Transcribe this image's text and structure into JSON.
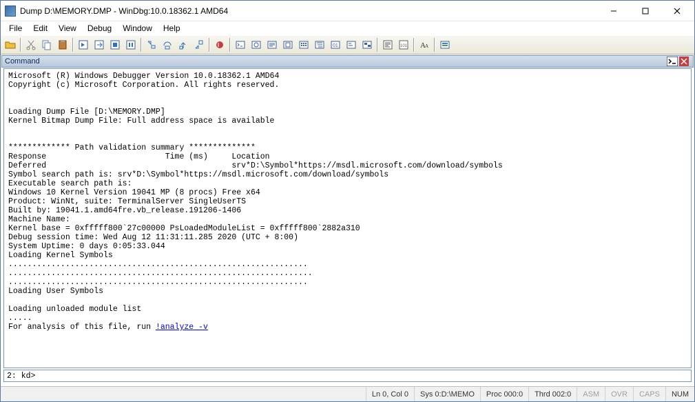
{
  "window": {
    "title": "Dump D:\\MEMORY.DMP - WinDbg:10.0.18362.1 AMD64"
  },
  "menu": {
    "file": "File",
    "edit": "Edit",
    "view": "View",
    "debug": "Debug",
    "window": "Window",
    "help": "Help"
  },
  "command": {
    "title": "Command",
    "text": "Microsoft (R) Windows Debugger Version 10.0.18362.1 AMD64\nCopyright (c) Microsoft Corporation. All rights reserved.\n\n\nLoading Dump File [D:\\MEMORY.DMP]\nKernel Bitmap Dump File: Full address space is available\n\n\n************* Path validation summary **************\nResponse                         Time (ms)     Location\nDeferred                                       srv*D:\\Symbol*https://msdl.microsoft.com/download/symbols\nSymbol search path is: srv*D:\\Symbol*https://msdl.microsoft.com/download/symbols\nExecutable search path is: \nWindows 10 Kernel Version 19041 MP (8 procs) Free x64\nProduct: WinNt, suite: TerminalServer SingleUserTS\nBuilt by: 19041.1.amd64fre.vb_release.191206-1406\nMachine Name:\nKernel base = 0xfffff800`27c00000 PsLoadedModuleList = 0xfffff800`2882a310\nDebug session time: Wed Aug 12 11:31:11.285 2020 (UTC + 8:00)\nSystem Uptime: 0 days 0:05:33.044\nLoading Kernel Symbols\n...............................................................\n................................................................\n...............................................................\nLoading User Symbols\n\nLoading unloaded module list\n.....\nFor analysis of this file, run ",
    "link": "!analyze -v",
    "prompt": "2: kd>"
  },
  "status": {
    "lncol": "Ln 0, Col 0",
    "sys": "Sys 0:D:\\MEMO",
    "proc": "Proc 000:0",
    "thrd": "Thrd 002:0",
    "asm": "ASM",
    "ovr": "OVR",
    "caps": "CAPS",
    "num": "NUM"
  }
}
